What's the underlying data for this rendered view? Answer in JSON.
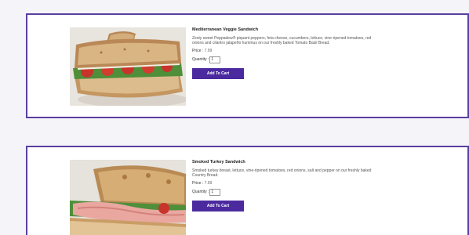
{
  "products": [
    {
      "title": "Mediterranean Veggie Sandwich",
      "description": "Zesty sweet Peppadew® piquant peppers, feta cheese, cucumbers, lettuce, vine-ripened tomatoes, red onions and cilantro jalapeño hummus on our freshly baked Tomato Basil Bread.",
      "price_label": "Price :",
      "price_value": "7.99",
      "quantity_label": "Quantity :",
      "quantity_value": "1",
      "button_label": "Add To Cart",
      "image_icon": "sandwich-photo"
    },
    {
      "title": "Smoked Turkey Sandwich",
      "description": "Smoked turkey breast, lettuce, vine-ripened tomatoes, red onions, salt and pepper on our freshly baked Country Bread.",
      "price_label": "Price :",
      "price_value": "7.99",
      "quantity_label": "Quantity :",
      "quantity_value": "1",
      "button_label": "Add To Cart",
      "image_icon": "sandwich-photo"
    }
  ],
  "colors": {
    "accent": "#4b2aa0",
    "card_border": "#5a3fa0",
    "background": "#f4f4f9"
  }
}
